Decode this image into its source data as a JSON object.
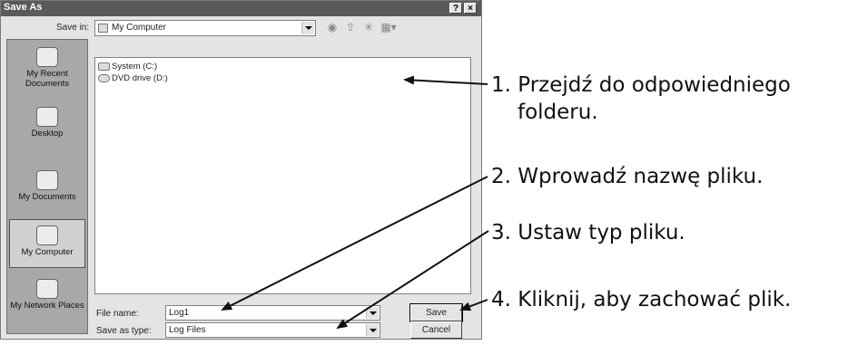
{
  "dialog": {
    "title": "Save As",
    "help_label": "?",
    "close_label": "×",
    "save_in_label": "Save in:",
    "save_in_value": "My Computer",
    "toolbar_icons": [
      "back-icon",
      "up-folder-icon",
      "new-folder-icon",
      "view-menu-icon"
    ],
    "places": [
      {
        "label": "My Recent Documents",
        "icon": "recent-documents-icon"
      },
      {
        "label": "Desktop",
        "icon": "desktop-icon"
      },
      {
        "label": "My Documents",
        "icon": "my-documents-icon"
      },
      {
        "label": "My Computer",
        "icon": "my-computer-icon"
      },
      {
        "label": "My Network Places",
        "icon": "network-places-icon"
      }
    ],
    "files": [
      {
        "label": "System (C:)",
        "icon": "hard-drive-icon"
      },
      {
        "label": "DVD drive (D:)",
        "icon": "dvd-drive-icon"
      }
    ],
    "file_name_label": "File name:",
    "file_name_value": "Log1",
    "save_as_type_label": "Save as type:",
    "save_as_type_value": "Log Files",
    "save_button": "Save",
    "cancel_button": "Cancel"
  },
  "callouts": [
    {
      "line1": "1. Przejdź do odpowiedniego",
      "line2": "folderu."
    },
    {
      "line1": "2. Wprowadź nazwę pliku."
    },
    {
      "line1": "3. Ustaw typ pliku."
    },
    {
      "line1": "4. Kliknij, aby zachować plik."
    }
  ]
}
